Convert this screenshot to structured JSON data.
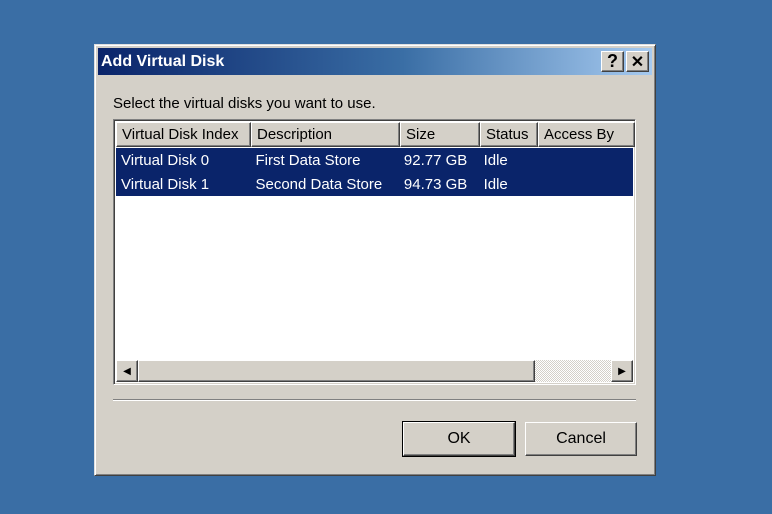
{
  "dialog": {
    "title": "Add Virtual Disk",
    "help_label": "?",
    "close_label": "✕",
    "instruction": "Select the virtual disks you want to use."
  },
  "table": {
    "columns": [
      "Virtual Disk Index",
      "Description",
      "Size",
      "Status",
      "Access By"
    ],
    "rows": [
      {
        "index": "Virtual Disk 0",
        "description": "First Data Store",
        "size": "92.77 GB",
        "status": "Idle",
        "access_by": ""
      },
      {
        "index": "Virtual Disk 1",
        "description": "Second Data Store",
        "size": "94.73 GB",
        "status": "Idle",
        "access_by": ""
      }
    ],
    "selected_rows": [
      0,
      1
    ]
  },
  "scrollbar": {
    "left_arrow": "◀",
    "right_arrow": "▶"
  },
  "buttons": {
    "ok": "OK",
    "cancel": "Cancel"
  },
  "colors": {
    "desktop": "#3a6ea5",
    "selection": "#0a246a",
    "dialog_face": "#d4d0c8"
  }
}
